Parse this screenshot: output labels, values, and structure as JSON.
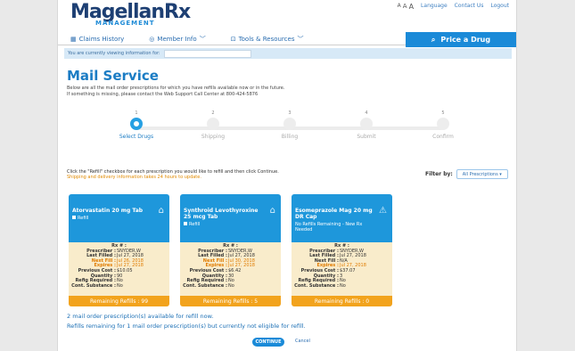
{
  "header": {
    "logo_main": "Magellan",
    "logo_rx": "Rx",
    "logo_sub": "MANAGEMENT",
    "font_sizes": [
      "A",
      "A",
      "A"
    ],
    "links": [
      "Language",
      "Contact Us",
      "Logout"
    ]
  },
  "nav": {
    "items": [
      {
        "label": "Claims History",
        "icon": "grid-icon"
      },
      {
        "label": "Member Info",
        "icon": "member-card-icon"
      },
      {
        "label": "Tools & Resources",
        "icon": "tools-icon"
      }
    ],
    "price_button": "Price a Drug"
  },
  "viewing_bar": {
    "label": "You are currently viewing information for:",
    "value": ""
  },
  "page": {
    "title": "Mail Service",
    "intro_line1": "Below are all the mail order prescriptions for which you have refills available now or in the future.",
    "intro_line2": "If something is missing, please contact the Web Support Call Center at 800-424-5876"
  },
  "steps": [
    {
      "num": "1",
      "label": "Select Drugs",
      "active": true
    },
    {
      "num": "2",
      "label": "Shipping",
      "active": false
    },
    {
      "num": "3",
      "label": "Billing",
      "active": false
    },
    {
      "num": "4",
      "label": "Submit",
      "active": false
    },
    {
      "num": "5",
      "label": "Confirm",
      "active": false
    }
  ],
  "instructions": {
    "line1": "Click the \"Refill\" checkbox for each prescription you would like to refill and then click Continue.",
    "line2": "Shipping and delivery information takes 24 hours to update."
  },
  "filter": {
    "label": "Filter by:",
    "selected": "All Prescriptions"
  },
  "cards": [
    {
      "name": "Atorvastatin 20 mg Tab",
      "status": "Refill",
      "rx_label": "Rx # :",
      "fields": [
        [
          "Prescriber :",
          "SNYDER,W"
        ],
        [
          "Last Filled :",
          "Jul 27, 2018"
        ],
        [
          "Next Fill :",
          "Jul 26, 2018"
        ],
        [
          "Expires :",
          "Jul 27, 2018"
        ],
        [
          "Previous Cost :",
          "$10.05"
        ],
        [
          "Quantity :",
          "90"
        ],
        [
          "Refig Required :",
          "No"
        ],
        [
          "Cont. Substance :",
          "No"
        ]
      ],
      "remaining": "Remaining Refills : 99"
    },
    {
      "name": "Synthroid Levothyroxine 25 mcg Tab",
      "status": "Refill",
      "rx_label": "Rx # :",
      "fields": [
        [
          "Prescriber :",
          "SNYDER,W"
        ],
        [
          "Last Filled :",
          "Jul 27, 2018"
        ],
        [
          "Next Fill :",
          "Jul 30, 2018"
        ],
        [
          "Expires :",
          "Jul 27, 2018"
        ],
        [
          "Previous Cost :",
          "$6.42"
        ],
        [
          "Quantity :",
          "30"
        ],
        [
          "Refig Required :",
          "No"
        ],
        [
          "Cont. Substance :",
          "No"
        ]
      ],
      "remaining": "Remaining Refills : 5"
    },
    {
      "name": "Esomeprazole Mag 20 mg DR Cap",
      "status": "No Refills Remaining - New Rx Needed",
      "rx_label": "Rx # :",
      "fields": [
        [
          "Prescriber :",
          "SNYDER,W"
        ],
        [
          "Last Filled :",
          "Jul 27, 2018"
        ],
        [
          "Next Fill :",
          "N/A"
        ],
        [
          "Expires :",
          "Jul 27, 2018"
        ],
        [
          "Previous Cost :",
          "$37.07"
        ],
        [
          "Quantity :",
          "3"
        ],
        [
          "Refig Required :",
          "No"
        ],
        [
          "Cont. Substance :",
          "No"
        ]
      ],
      "remaining": "Remaining Refills : 0"
    }
  ],
  "summary": {
    "line1": "2 mail order prescription(s) available for refill now.",
    "line2": "Refills remaining for 1 mail order prescription(s) but currently not eligible for refill."
  },
  "buttons": {
    "continue": "CONTINUE",
    "cancel": "Cancel"
  },
  "colors": {
    "primary": "#1a8ad8",
    "card_header": "#1e97db",
    "card_body": "#f9eccb",
    "refill_bar": "#f2a31d",
    "highlight": "#e07b00"
  }
}
